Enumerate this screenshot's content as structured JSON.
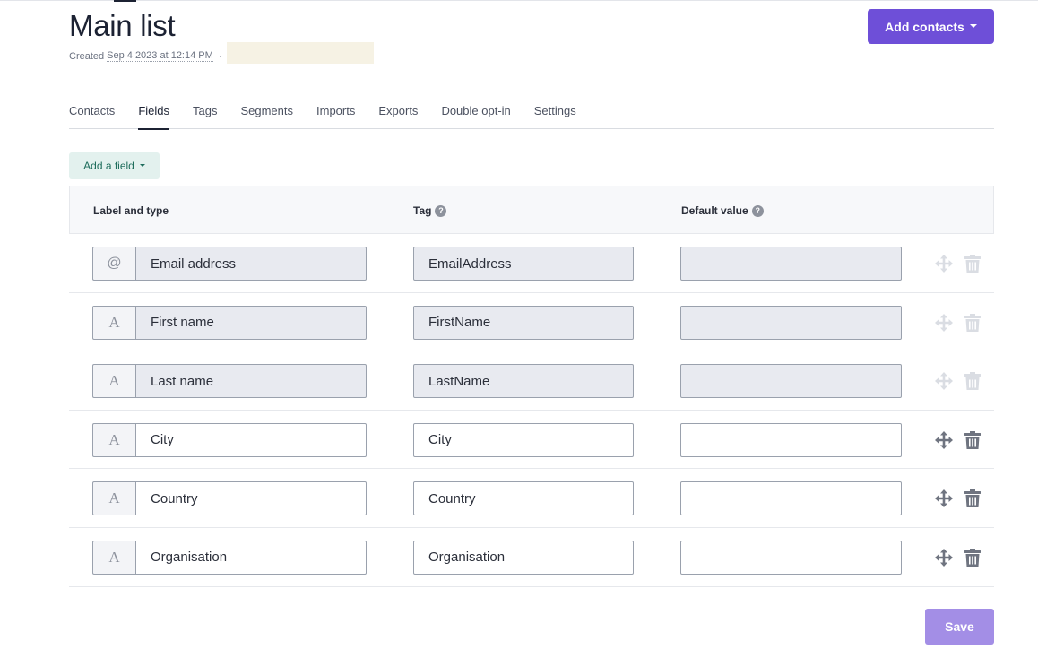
{
  "page": {
    "title": "Main list",
    "created_prefix": "Created",
    "created_date": "Sep 4 2023 at 12:14 PM",
    "created_separator": "·"
  },
  "header": {
    "add_contacts_label": "Add contacts"
  },
  "tabs": [
    {
      "label": "Contacts",
      "active": false
    },
    {
      "label": "Fields",
      "active": true
    },
    {
      "label": "Tags",
      "active": false
    },
    {
      "label": "Segments",
      "active": false
    },
    {
      "label": "Imports",
      "active": false
    },
    {
      "label": "Exports",
      "active": false
    },
    {
      "label": "Double opt-in",
      "active": false
    },
    {
      "label": "Settings",
      "active": false
    }
  ],
  "toolbar": {
    "add_field_label": "Add a field"
  },
  "table": {
    "columns": {
      "label_type": "Label and type",
      "tag": "Tag",
      "default_value": "Default value",
      "help_glyph": "?"
    },
    "rows": [
      {
        "type_icon": "@",
        "label": "Email address",
        "tag": "EmailAddress",
        "default_value": "",
        "locked": true
      },
      {
        "type_icon": "A",
        "label": "First name",
        "tag": "FirstName",
        "default_value": "",
        "locked": true
      },
      {
        "type_icon": "A",
        "label": "Last name",
        "tag": "LastName",
        "default_value": "",
        "locked": true
      },
      {
        "type_icon": "A",
        "label": "City",
        "tag": "City",
        "default_value": "",
        "locked": false
      },
      {
        "type_icon": "A",
        "label": "Country",
        "tag": "Country",
        "default_value": "",
        "locked": false
      },
      {
        "type_icon": "A",
        "label": "Organisation",
        "tag": "Organisation",
        "default_value": "",
        "locked": false
      }
    ]
  },
  "footer": {
    "save_label": "Save"
  },
  "colors": {
    "primary": "#6e4fd8",
    "primary_disabled": "#a38ee6",
    "add_field_bg": "#e3f1ee",
    "add_field_text": "#1e6d5c",
    "locked_field_bg": "#e8eaf0",
    "icon_active": "#6f7480",
    "icon_disabled": "#dadde3"
  }
}
